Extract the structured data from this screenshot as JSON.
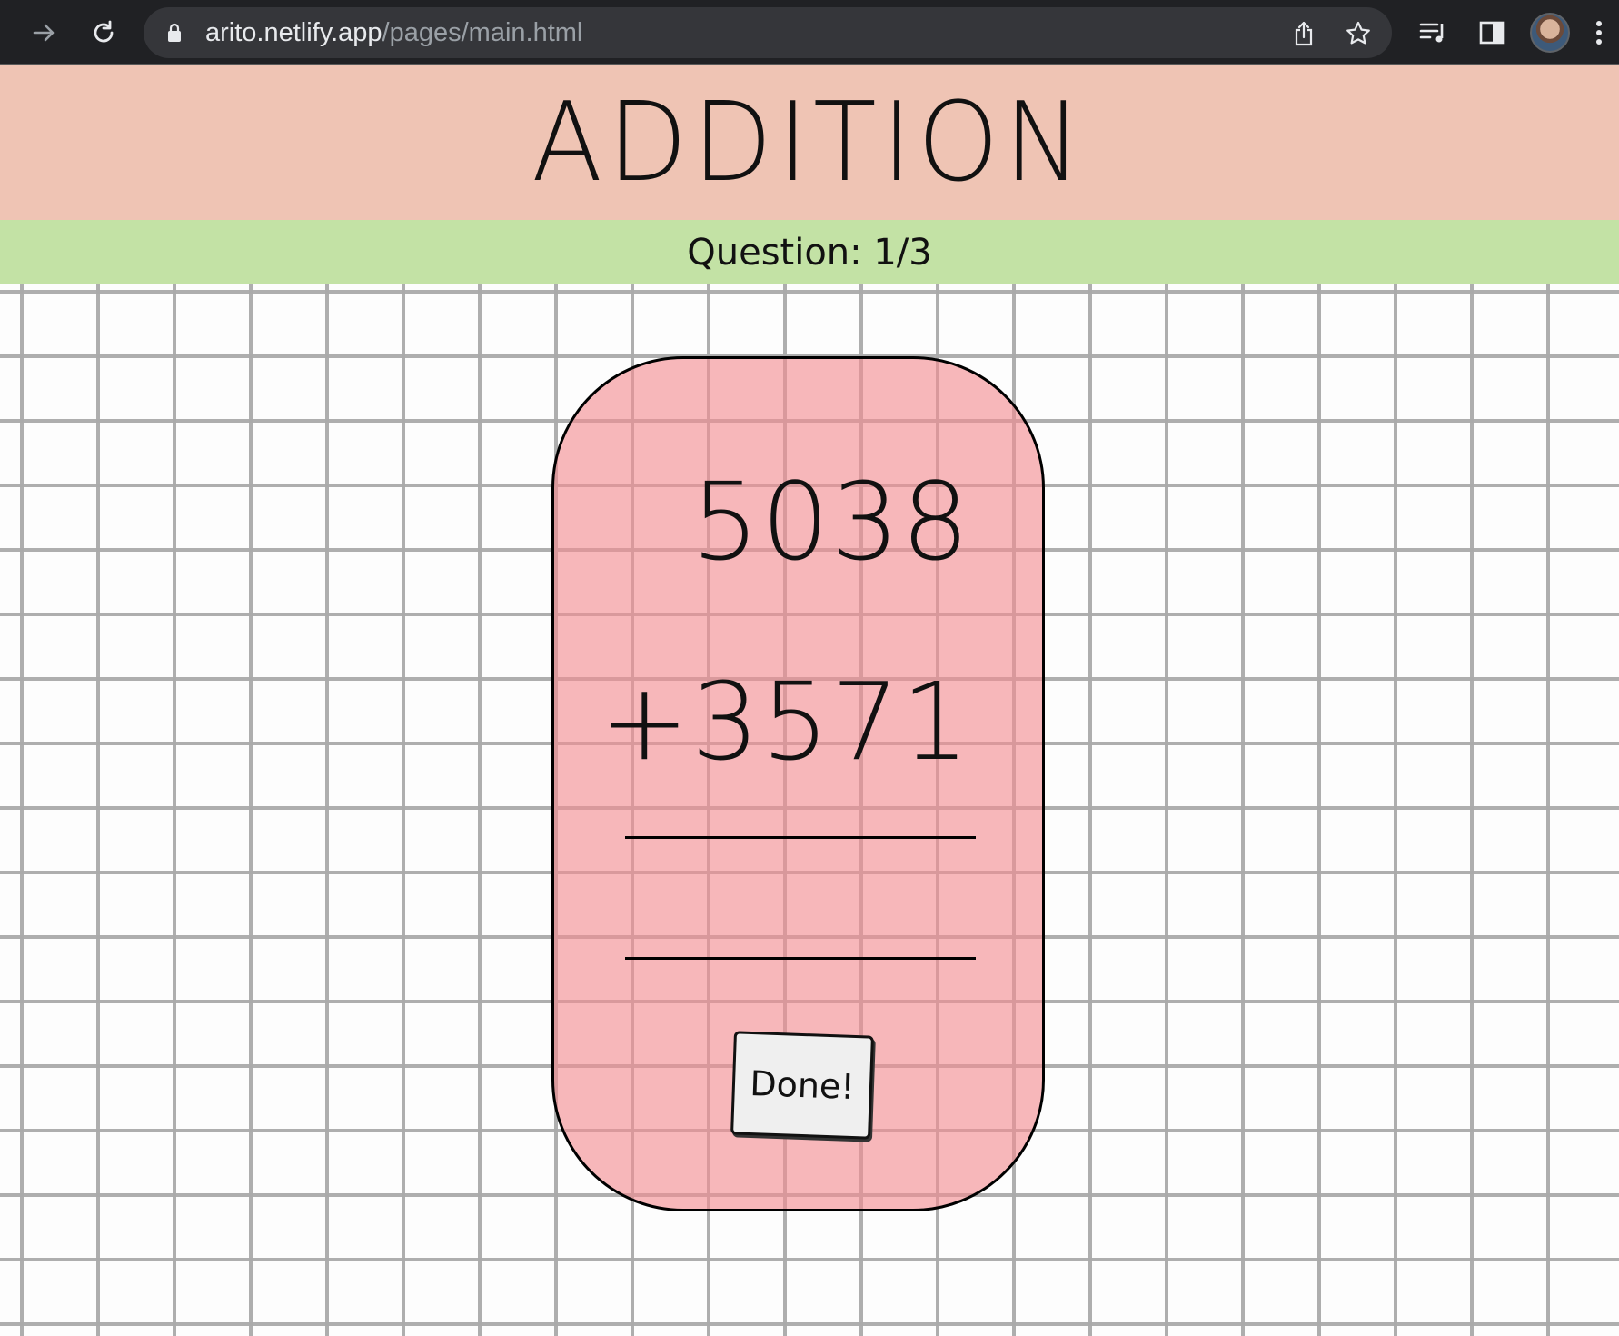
{
  "browser": {
    "url_host": "arito.netlify.app",
    "url_path": "/pages/main.html"
  },
  "page": {
    "title": "ADDITION",
    "question_label": "Question: 1/3"
  },
  "problem": {
    "first_operand": "5038",
    "second_operand": "+3571",
    "done_label": "Done!"
  }
}
